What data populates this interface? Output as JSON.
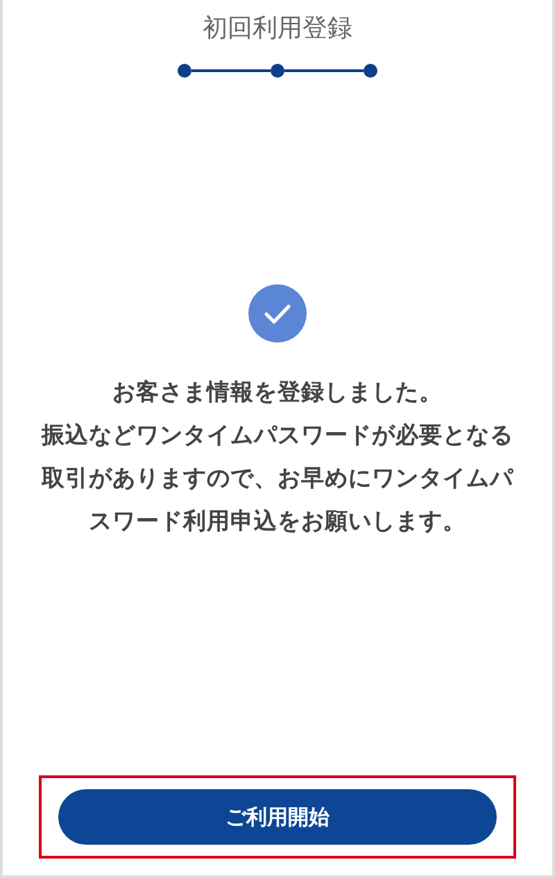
{
  "header": {
    "title": "初回利用登録"
  },
  "steps": [
    {
      "done": true
    },
    {
      "done": true
    },
    {
      "done": true
    }
  ],
  "message": {
    "lines": [
      "お客さま情報を登録しました。",
      "振込などワンタイムパスワードが必要となる",
      "取引がありますので、お早めにワンタイムパ",
      "スワード利用申込をお願いします。"
    ]
  },
  "start_button": {
    "label": "ご利用開始",
    "highlighted": true
  }
}
